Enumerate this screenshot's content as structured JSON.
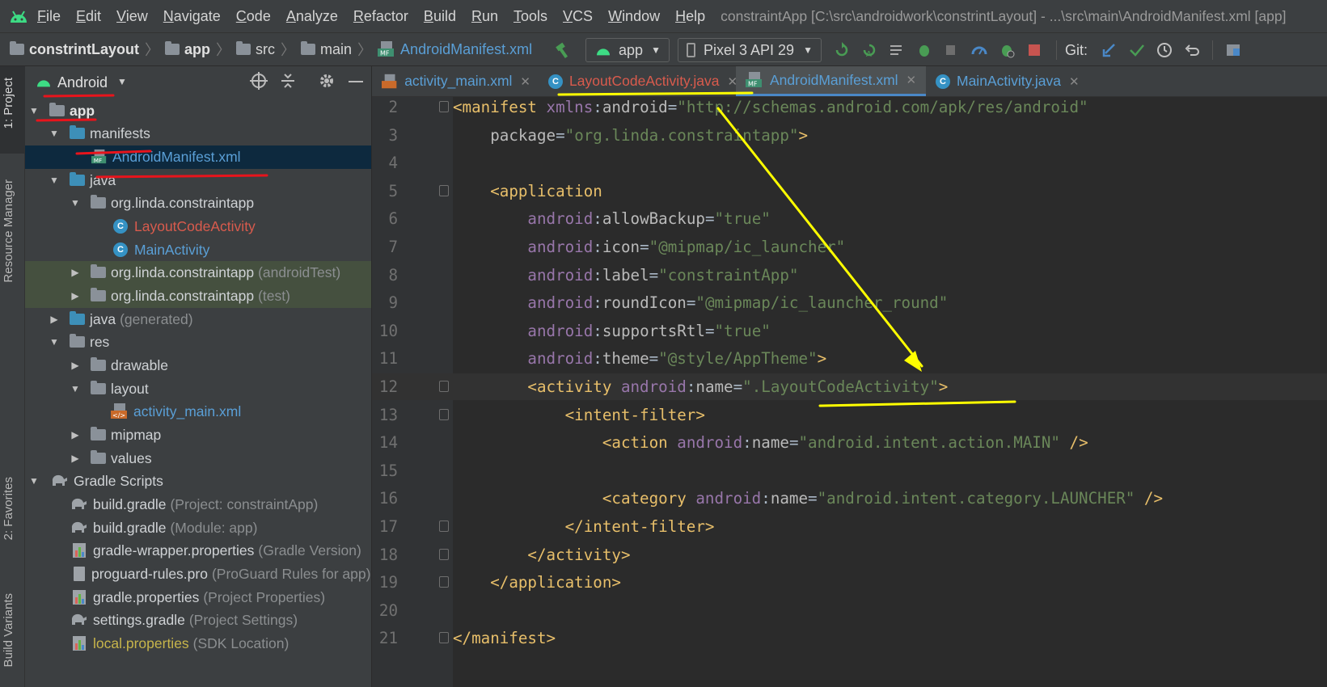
{
  "menubar": {
    "items": [
      "File",
      "Edit",
      "View",
      "Navigate",
      "Code",
      "Analyze",
      "Refactor",
      "Build",
      "Run",
      "Tools",
      "VCS",
      "Window",
      "Help"
    ],
    "title": "constraintApp [C:\\src\\androidwork\\constrintLayout] - ...\\src\\main\\AndroidManifest.xml [app]"
  },
  "navbar": {
    "breadcrumbs": [
      "constrintLayout",
      "app",
      "src",
      "main",
      "AndroidManifest.xml"
    ],
    "run_config": "app",
    "device": "Pixel 3 API 29",
    "git_label": "Git:"
  },
  "leftstrip": {
    "project_tab": "1: Project",
    "resource_tab": "Resource Manager",
    "favorites_tab": "2: Favorites",
    "variants_tab": "Build Variants"
  },
  "project": {
    "view_selector": "Android",
    "tree": [
      {
        "label": "app",
        "note": ""
      },
      {
        "label": "manifests",
        "note": ""
      },
      {
        "label": "AndroidManifest.xml",
        "note": ""
      },
      {
        "label": "java",
        "note": ""
      },
      {
        "label": "org.linda.constraintapp",
        "note": ""
      },
      {
        "label": "LayoutCodeActivity",
        "note": ""
      },
      {
        "label": "MainActivity",
        "note": ""
      },
      {
        "label": "org.linda.constraintapp",
        "note": "(androidTest)"
      },
      {
        "label": "org.linda.constraintapp",
        "note": "(test)"
      },
      {
        "label": "java",
        "note": "(generated)"
      },
      {
        "label": "res",
        "note": ""
      },
      {
        "label": "drawable",
        "note": ""
      },
      {
        "label": "layout",
        "note": ""
      },
      {
        "label": "activity_main.xml",
        "note": ""
      },
      {
        "label": "mipmap",
        "note": ""
      },
      {
        "label": "values",
        "note": ""
      },
      {
        "label": "Gradle Scripts",
        "note": ""
      },
      {
        "label": "build.gradle",
        "note": "(Project: constraintApp)"
      },
      {
        "label": "build.gradle",
        "note": "(Module: app)"
      },
      {
        "label": "gradle-wrapper.properties",
        "note": "(Gradle Version)"
      },
      {
        "label": "proguard-rules.pro",
        "note": "(ProGuard Rules for app)"
      },
      {
        "label": "gradle.properties",
        "note": "(Project Properties)"
      },
      {
        "label": "settings.gradle",
        "note": "(Project Settings)"
      },
      {
        "label": "local.properties",
        "note": "(SDK Location)"
      }
    ]
  },
  "tabs": [
    {
      "label": "activity_main.xml"
    },
    {
      "label": "LayoutCodeActivity.java"
    },
    {
      "label": "AndroidManifest.xml"
    },
    {
      "label": "MainActivity.java"
    }
  ],
  "editor": {
    "current_line": "12",
    "lines": [
      {
        "num": "2",
        "text": "<manifest xmlns:android=\"http://schemas.android.com/apk/res/android\""
      },
      {
        "num": "3",
        "text": "    package=\"org.linda.constraintapp\">"
      },
      {
        "num": "4",
        "text": ""
      },
      {
        "num": "5",
        "text": "    <application"
      },
      {
        "num": "6",
        "text": "        android:allowBackup=\"true\""
      },
      {
        "num": "7",
        "text": "        android:icon=\"@mipmap/ic_launcher\""
      },
      {
        "num": "8",
        "text": "        android:label=\"constraintApp\""
      },
      {
        "num": "9",
        "text": "        android:roundIcon=\"@mipmap/ic_launcher_round\""
      },
      {
        "num": "10",
        "text": "        android:supportsRtl=\"true\""
      },
      {
        "num": "11",
        "text": "        android:theme=\"@style/AppTheme\">"
      },
      {
        "num": "12",
        "text": "        <activity android:name=\".LayoutCodeActivity\">"
      },
      {
        "num": "13",
        "text": "            <intent-filter>"
      },
      {
        "num": "14",
        "text": "                <action android:name=\"android.intent.action.MAIN\" />"
      },
      {
        "num": "15",
        "text": ""
      },
      {
        "num": "16",
        "text": "                <category android:name=\"android.intent.category.LAUNCHER\" />"
      },
      {
        "num": "17",
        "text": "            </intent-filter>"
      },
      {
        "num": "18",
        "text": "        </activity>"
      },
      {
        "num": "19",
        "text": "    </application>"
      },
      {
        "num": "20",
        "text": ""
      },
      {
        "num": "21",
        "text": "</manifest>"
      }
    ]
  },
  "colors": {
    "annotation_red": "#e8141c",
    "annotation_yellow": "#ffff00",
    "tag": "#e8bf6a",
    "namespace": "#9876aa",
    "string": "#6a8759"
  }
}
